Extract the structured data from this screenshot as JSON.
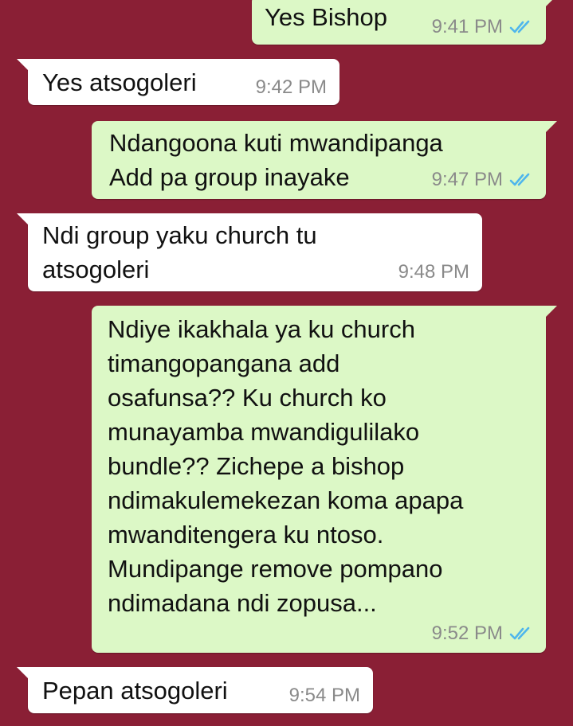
{
  "messages": [
    {
      "id": "m1",
      "direction": "outgoing",
      "text": "Yes Bishop",
      "time": "9:41 PM",
      "status": "read"
    },
    {
      "id": "m2",
      "direction": "incoming",
      "text": "Yes atsogoleri",
      "time": "9:42 PM"
    },
    {
      "id": "m3",
      "direction": "outgoing",
      "text": "Ndangoona kuti mwandipanga\nAdd pa group inayake",
      "time": "9:47 PM",
      "status": "read"
    },
    {
      "id": "m4",
      "direction": "incoming",
      "text": "Ndi group yaku church tu\natsogoleri",
      "time": "9:48 PM"
    },
    {
      "id": "m5",
      "direction": "outgoing",
      "text": "Ndiye ikakhala ya ku church\ntimangopangana add\nosafunsa?? Ku church ko\nmunayamba mwandigulilako\nbundle?? Zichepe a bishop\nndimakulemekezan koma apapa\nmwanditengera ku ntoso.\nMundipange remove pompano\nndimadana ndi zopusa...",
      "time": "9:52 PM",
      "status": "read"
    },
    {
      "id": "m6",
      "direction": "incoming",
      "text": "Pepan atsogoleri",
      "time": "9:54 PM"
    }
  ],
  "colors": {
    "background": "#8a1f35",
    "outgoing_bubble": "#dcf8c6",
    "incoming_bubble": "#ffffff",
    "read_ticks": "#4fb6ec",
    "timestamp": "#8a8a8a"
  },
  "icons": {
    "read_receipt": "double-check-icon"
  }
}
